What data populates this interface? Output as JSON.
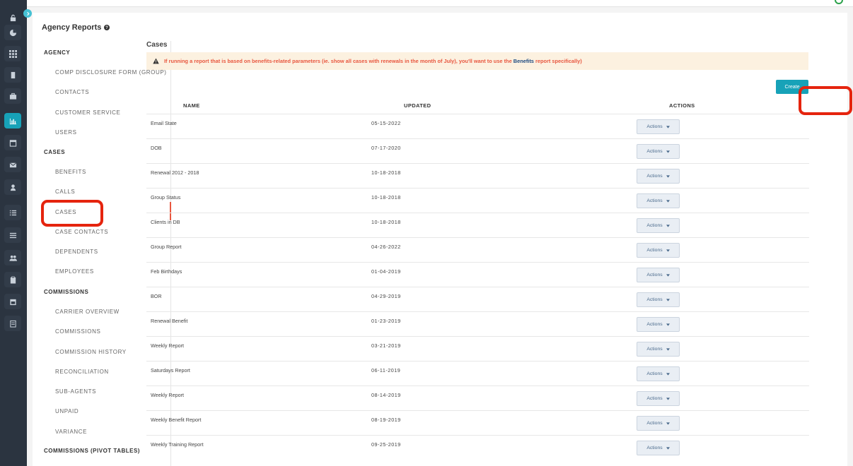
{
  "page_title": "Agency Reports",
  "nav": {
    "groups": [
      {
        "label": "AGENCY",
        "items": [
          "COMP DISCLOSURE FORM (GROUP)",
          "CONTACTS",
          "CUSTOMER SERVICE",
          "USERS"
        ]
      },
      {
        "label": "CASES",
        "items": [
          "BENEFITS",
          "CALLS",
          "CASES",
          "CASE CONTACTS",
          "DEPENDENTS",
          "EMPLOYEES"
        ]
      },
      {
        "label": "COMMISSIONS",
        "items": [
          "CARRIER OVERVIEW",
          "COMMISSIONS",
          "COMMISSION HISTORY",
          "RECONCILIATION",
          "SUB-AGENTS",
          "UNPAID",
          "VARIANCE"
        ]
      },
      {
        "label": "COMMISSIONS (PIVOT TABLES)",
        "items": []
      }
    ],
    "active_item": "CASES"
  },
  "main": {
    "title": "Cases",
    "alert": {
      "before": "If running a report that is based on benefits-related parameters (ie. show all cases with renewals in the month of July), you'll want to use the",
      "link": "Benefits",
      "after": "report specifically)"
    },
    "create_label": "Create",
    "columns": [
      "NAME",
      "UPDATED",
      "ACTIONS"
    ],
    "action_label": "Actions",
    "rows": [
      {
        "name": "Email State",
        "updated": "05-15-2022"
      },
      {
        "name": "DOB",
        "updated": "07-17-2020"
      },
      {
        "name": "Renewal 2012 - 2018",
        "updated": "10-18-2018"
      },
      {
        "name": "Group Status",
        "updated": "10-18-2018"
      },
      {
        "name": "Clients in DB",
        "updated": "10-18-2018"
      },
      {
        "name": "Group Report",
        "updated": "04-26-2022"
      },
      {
        "name": "Feb Birthdays",
        "updated": "01-04-2019"
      },
      {
        "name": "BOR",
        "updated": "04-29-2019"
      },
      {
        "name": "Renewal Benefit",
        "updated": "01-23-2019"
      },
      {
        "name": "Weekly Report",
        "updated": "03-21-2019"
      },
      {
        "name": "Saturdays Report",
        "updated": "06-11-2019"
      },
      {
        "name": "Weekly Report",
        "updated": "08-14-2019"
      },
      {
        "name": "Weekly Benefit Report",
        "updated": "08-19-2019"
      },
      {
        "name": "Weekly Training Report",
        "updated": "09-25-2019"
      }
    ]
  },
  "rail_icons": [
    "lock-icon",
    "dashboard-icon",
    "grid-icon",
    "book-icon",
    "briefcase-icon",
    "reports-icon",
    "calendar-icon",
    "mail-icon",
    "user-icon",
    "list-icon",
    "menu-icon",
    "users-icon",
    "clipboard-icon",
    "calendar-alt-icon",
    "document-icon"
  ],
  "colors": {
    "accent": "#17a2b8",
    "highlight": "#e5240e",
    "alert_text": "#e8573f",
    "rail_bg": "#2b3440"
  }
}
